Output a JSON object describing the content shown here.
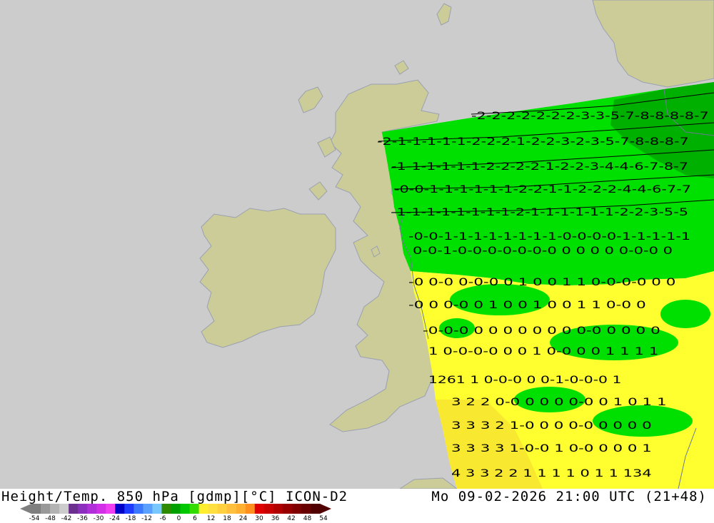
{
  "header": {
    "product": "Height/Temp. 850 hPa [gdmp][°C] ICON-D2",
    "valid_time": "Mo 09-02-2026 21:00 UTC (21+48)"
  },
  "legend": {
    "colors": [
      "#7f7f7f",
      "#999999",
      "#b3b3b3",
      "#cccccc",
      "#6a2f8f",
      "#8c2fbf",
      "#b02fd9",
      "#d22fe8",
      "#f03ff0",
      "#0000c8",
      "#1e3cff",
      "#3c78ff",
      "#5aa0ff",
      "#78c8ff",
      "#2e8b00",
      "#00a000",
      "#00c800",
      "#32dc00",
      "#ffee30",
      "#ffe040",
      "#ffd040",
      "#ffc040",
      "#ffb030",
      "#ff9020",
      "#e00000",
      "#c80000",
      "#b00000",
      "#980000",
      "#800000",
      "#680000",
      "#500000"
    ],
    "tick_labels": [
      "-54",
      "-48",
      "-42",
      "-36",
      "-30",
      "-24",
      "-18",
      "-12",
      "-6",
      "0",
      "6",
      "12",
      "18",
      "24",
      "30",
      "36",
      "42",
      "48",
      "54"
    ]
  },
  "map": {
    "colors": {
      "sea": "#cccccc",
      "land": "#cccc99",
      "border": "#9aa0b0",
      "green": "#00e000",
      "dark_green": "#00b000",
      "yellow": "#ffff30",
      "yellow_warm": "#f8e830"
    },
    "contour_rows": [
      "-2-2-2-2-2-2-2-3-3-5-7-8-8-8-8-7",
      "-2-1-1-1-1-1-2-2-2-1-2-2-3-2-3-5-7-8-8-8-7",
      "-1-1-1-1-1-1-2-2-2-2-1-2-2-3-4-4-6-7-8-7",
      "-0-0-1-1-1-1-1-1-2-2-1-1-2-2-2-4-4-6-7-7",
      "-1-1-1-1-1-1-1-1-2-1-1-1-1-1-1-2-2-3-5-5",
      "-0-0-1-1-1-1-1-1-1-1-0-0-0-0-1-1-1-1-1",
      "0-0-1-0-0-0-0-0-0-0 0 0 0 0 0-0-0 0",
      "-0 0-0 0-0-0 0 1 0 0 1 1 0-0-0-0 0 0",
      "-0 0 0-0 0 1 0 0 1 0 0 1 1 0-0 0",
      "-0-0-0 0 0 0 0 0 0 0 0-0 0 0 0 0",
      "1 0-0-0-0 0 0 1 0-0 0 0 1 1 1 1",
      "1261 1 0-0-0 0 0-1-0-0-0 1",
      "3 2 2 0-0 0 0 0 0-0 0 1 0 1 1",
      "3 3 3 2 1-0 0 0 0-0 0 0 0 0",
      "3 3 3 3 1-0-0 1 0-0 0 0 0 1",
      "4 3 3 2 2 1 1 1 1 0 1 1 134"
    ]
  }
}
